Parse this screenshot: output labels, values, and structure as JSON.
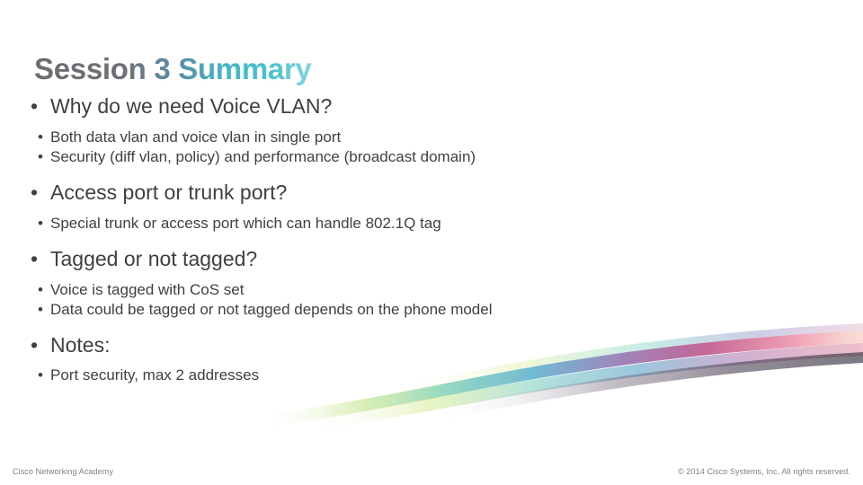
{
  "slide": {
    "title": "Session 3 Summary",
    "sections": [
      {
        "heading": "Why do we need Voice VLAN?",
        "points": [
          "Both data vlan and voice vlan in single port",
          "Security (diff vlan, policy) and performance (broadcast domain)"
        ]
      },
      {
        "heading": "Access port or trunk port?",
        "points": [
          "Special trunk or access port which can handle 802.1Q tag"
        ]
      },
      {
        "heading": "Tagged or not tagged?",
        "points": [
          "Voice is tagged with CoS set",
          "Data could be tagged or not tagged depends on the phone model"
        ]
      },
      {
        "heading": "Notes:",
        "points": [
          "Port security, max 2 addresses"
        ]
      }
    ],
    "bullet_glyph": "•",
    "footer": {
      "left": "Cisco Networking Academy",
      "right": "© 2014 Cisco Systems, Inc. All rights reserved."
    },
    "colors": {
      "text": "#404040",
      "title_gradient_start": "#6d6e71",
      "title_gradient_end": "#49c3cf",
      "footer_text": "#808080"
    }
  }
}
